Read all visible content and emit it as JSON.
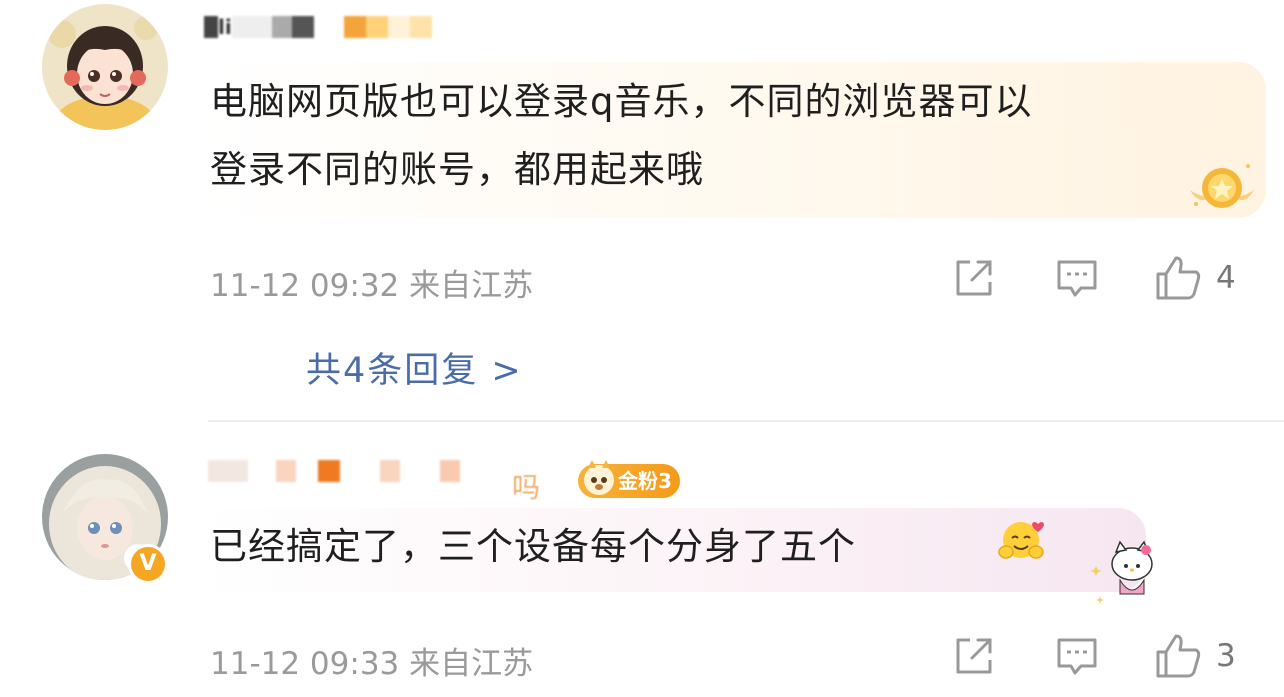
{
  "comments": [
    {
      "username_masked": "li",
      "text_lines": [
        "电脑网页版也可以登录q音乐，不同的浏览器可以",
        "登录不同的账号，都用起来哦"
      ],
      "meta": "11-12 09:32 来自江苏",
      "likes": "4",
      "replies_link": "共4条回复 >"
    },
    {
      "username_suffix": "吗",
      "fan_badge": "金粉3",
      "verified_badge": "V",
      "text_lines": [
        "已经搞定了，三个设备每个分身了五个"
      ],
      "meta": "11-12 09:33 来自江苏",
      "likes": "3"
    }
  ],
  "icons": {
    "share": "share-icon",
    "reply": "comment-icon",
    "like": "thumb-up-icon",
    "medal": "gold-medal-icon",
    "emoji": "hugging-face-icon",
    "sticker": "hello-kitty-sticker"
  },
  "colors": {
    "link": "#4a6da7",
    "meta": "#9a9a9a",
    "gold_badge": "#f59a19"
  }
}
